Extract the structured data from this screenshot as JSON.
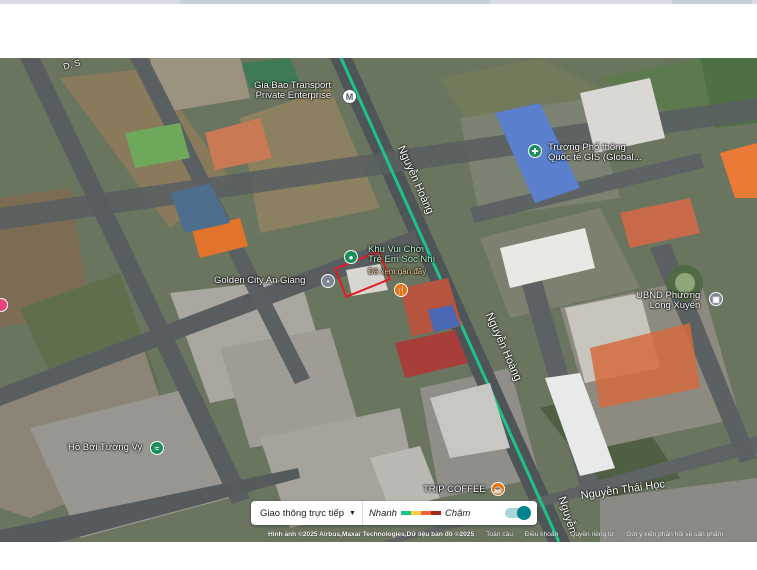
{
  "map": {
    "pois": {
      "gia_bao": "Gia Bao Transport\nPrivate Enterprise",
      "truong_gis": "Trường Phổ thông\nQuốc tế GIS (Global...",
      "khu_vui_choi": "Khu Vui Chơi\nTrẻ Em Sóc Nhí",
      "khu_vui_choi_sub": "Đã xem gần đây",
      "golden_city": "Golden City An Giang",
      "ubnd": "UBND Phường\nLong Xuyên",
      "ho_boi": "Hồ Bơi Tường Vy",
      "trip_coffee": "TRIP COFFEE"
    },
    "roads": {
      "nguyen_hoang_top": "Nguyễn Hoàng",
      "nguyen_hoang_mid": "Nguyễn Hoàng",
      "nguyen_hoang_bottom": "Nguyễn",
      "nguyen_thai_hoc": "Nguyễn Thái Học",
      "small_road": "D. S"
    },
    "metro_symbol": "M"
  },
  "traffic": {
    "mode_label": "Giao thông trực tiếp",
    "fast_label": "Nhanh",
    "slow_label": "Chậm",
    "colors": [
      "#1ec487",
      "#ffcf44",
      "#f2603a",
      "#a52714"
    ]
  },
  "attribution": {
    "imagery": "Hình ảnh ©2025 Airbus,Maxar Technologies,Dữ liệu bản đồ ©2025",
    "terms": "Điều khoản",
    "privacy": "Quyền riêng tư",
    "feedback": "Gửi ý kiến phản hồi về sản phẩm",
    "scale": "Toàn cầu"
  },
  "colors": {
    "traffic_fast": "#1ec487",
    "accent_pin_green": "#17915b",
    "pin_orange": "#e8710a",
    "selection": "#e31b23"
  }
}
